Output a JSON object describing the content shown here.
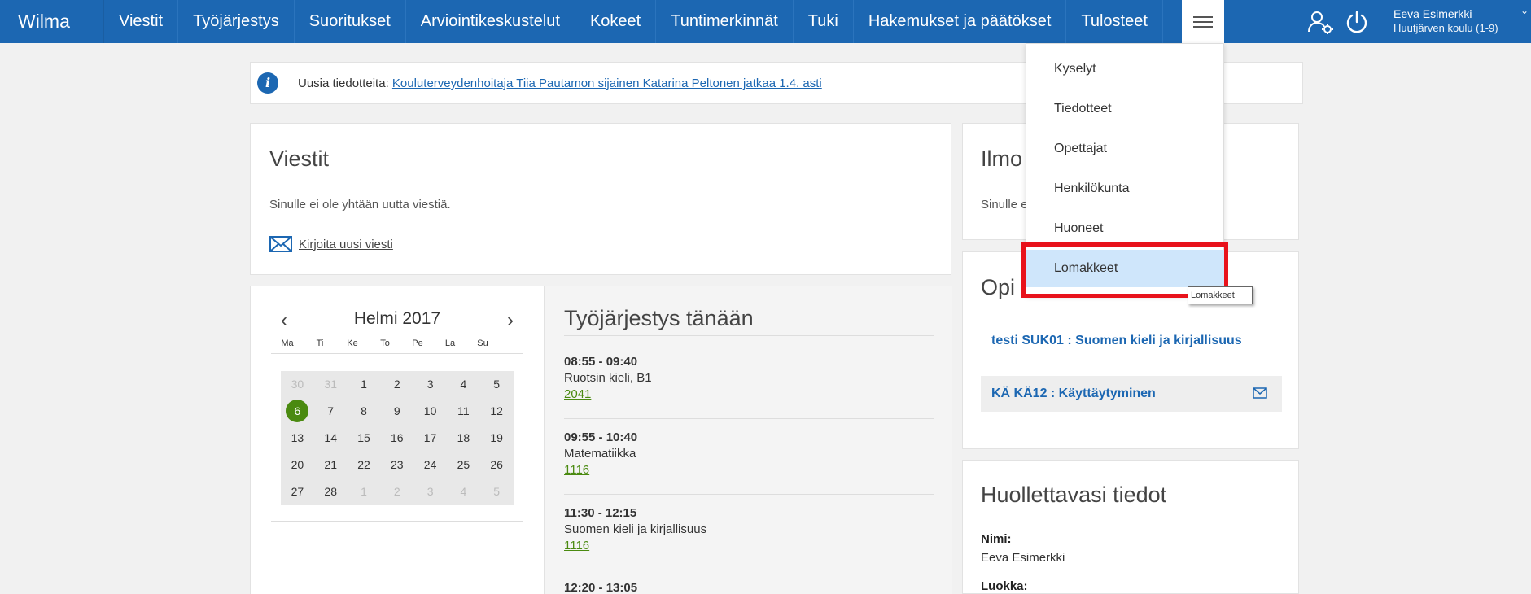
{
  "app": {
    "brand": "Wilma"
  },
  "nav": {
    "items": [
      "Viestit",
      "Työjärjestys",
      "Suoritukset",
      "Arviointikeskustelut",
      "Kokeet",
      "Tuntimerkinnät",
      "Tuki",
      "Hakemukset ja päätökset",
      "Tulosteet"
    ],
    "menu_icon": "hamburger-icon"
  },
  "user": {
    "name": "Eeva Esimerkki",
    "school": "Huutjärven koulu (1-9)",
    "switch_icon": "user-switch-icon",
    "logout_icon": "power-icon"
  },
  "dropdown": {
    "items": [
      "Kyselyt",
      "Tiedotteet",
      "Opettajat",
      "Henkilökunta",
      "Huoneet",
      "Lomakkeet"
    ],
    "tooltip": "Lomakkeet"
  },
  "notice": {
    "prefix": "Uusia tiedotteita:",
    "link": "Kouluterveydenhoitaja Tiia Pautamon sijainen Katarina Peltonen jatkaa 1.4. asti"
  },
  "messages": {
    "title": "Viestit",
    "empty": "Sinulle ei ole yhtään uutta viestiä.",
    "compose": "Kirjoita uusi viesti"
  },
  "calendar": {
    "month": "Helmi 2017",
    "prev": "‹",
    "next": "›",
    "weekdays": [
      "Ma",
      "Ti",
      "Ke",
      "To",
      "Pe",
      "La",
      "Su"
    ],
    "weeks": [
      [
        "30",
        "31",
        "1",
        "2",
        "3",
        "4",
        "5"
      ],
      [
        "6",
        "7",
        "8",
        "9",
        "10",
        "11",
        "12"
      ],
      [
        "13",
        "14",
        "15",
        "16",
        "17",
        "18",
        "19"
      ],
      [
        "20",
        "21",
        "22",
        "23",
        "24",
        "25",
        "26"
      ],
      [
        "27",
        "28",
        "1",
        "2",
        "3",
        "4",
        "5"
      ]
    ],
    "today": "6"
  },
  "schedule": {
    "title": "Työjärjestys tänään",
    "lessons": [
      {
        "time": "08:55 - 09:40",
        "subject": "Ruotsin kieli, B1",
        "room": "2041"
      },
      {
        "time": "09:55 - 10:40",
        "subject": "Matematiikka",
        "room": "1116"
      },
      {
        "time": "11:30 - 12:15",
        "subject": "Suomen kieli ja kirjallisuus",
        "room": "1116"
      },
      {
        "time": "12:20 - 13:05",
        "subject": "",
        "room": ""
      }
    ]
  },
  "ilmo": {
    "title": "Ilmo",
    "text": "Sinulle e"
  },
  "opi": {
    "title": "Opi",
    "courses": [
      "testi SUK01 : Suomen kieli ja kirjallisuus",
      "KÄ KÄ12 : Käyttäytyminen"
    ]
  },
  "guardian": {
    "title": "Huollettavasi tiedot",
    "name_label": "Nimi:",
    "name_value": "Eeva Esimerkki",
    "class_label": "Luokka:"
  },
  "colors": {
    "brand": "#1c67b2",
    "today": "#4a8a10",
    "highlight": "#e8121b"
  }
}
